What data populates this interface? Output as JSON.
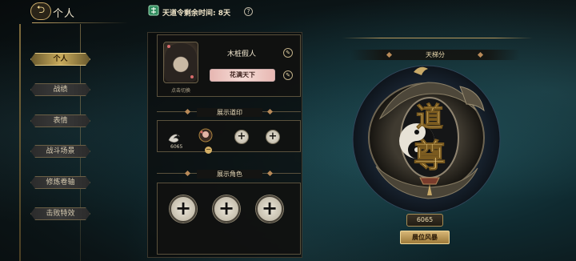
{
  "header": {
    "back_glyph": "⮌",
    "title": "个人",
    "token_text": "天道令剩余时间: 8天",
    "help_glyph": "?"
  },
  "sidebar": {
    "items": [
      {
        "label": "个人",
        "active": true
      },
      {
        "label": "战绩",
        "active": false
      },
      {
        "label": "表情",
        "active": false
      },
      {
        "label": "战斗场景",
        "active": false
      },
      {
        "label": "修炼卷轴",
        "active": false
      },
      {
        "label": "击败特效",
        "active": false
      }
    ]
  },
  "profile": {
    "avatar_caption": "点击切换",
    "name": "木桩假人",
    "plate_title": "花满天下",
    "edit_glyph": "✎"
  },
  "seals": {
    "title": "展示道印",
    "first_label": "6065",
    "minus_glyph": "−",
    "plus_glyph": "+"
  },
  "roles": {
    "title": "展示角色",
    "plus_glyph": "+"
  },
  "ladder": {
    "title": "天梯分",
    "emblem_text_top": "道",
    "emblem_text_bottom": "尊",
    "score": "6065",
    "button_label": "晨位风暴"
  },
  "colors": {
    "gold": "#c8a968",
    "plate_pink": "#f5dcd6",
    "active_tab": "#c9ab5c"
  }
}
